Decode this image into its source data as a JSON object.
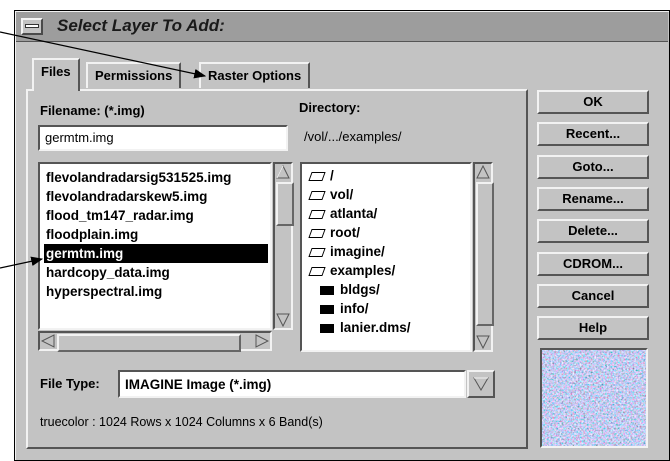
{
  "window": {
    "title": "Select Layer To Add:"
  },
  "tabs": [
    {
      "label": "Files",
      "active": true
    },
    {
      "label": "Permissions"
    },
    {
      "label": "Raster Options"
    }
  ],
  "filename": {
    "label": "Filename: (*.img)",
    "value": "germtm.img"
  },
  "directory": {
    "label": "Directory:",
    "path": "/vol/.../examples/"
  },
  "files": [
    "flevolandradarsig531525.img",
    "flevolandradarskew5.img",
    "flood_tm147_radar.img",
    "floodplain.img",
    "germtm.img",
    "hardcopy_data.img",
    "hyperspectral.img"
  ],
  "selected_file": "germtm.img",
  "directories": [
    {
      "name": "/",
      "icon": "open-folder-icon"
    },
    {
      "name": "vol/",
      "icon": "open-folder-icon"
    },
    {
      "name": "atlanta/",
      "icon": "open-folder-icon"
    },
    {
      "name": "root/",
      "icon": "open-folder-icon"
    },
    {
      "name": "imagine/",
      "icon": "open-folder-icon"
    },
    {
      "name": "examples/",
      "icon": "open-folder-icon"
    },
    {
      "name": "bldgs/",
      "icon": "folder-icon"
    },
    {
      "name": "info/",
      "icon": "folder-icon"
    },
    {
      "name": "lanier.dms/",
      "icon": "folder-icon"
    }
  ],
  "file_type": {
    "label": "File Type:",
    "value": "IMAGINE Image (*.img)"
  },
  "status": "truecolor : 1024 Rows x 1024 Columns x 6 Band(s)",
  "buttons": {
    "ok": "OK",
    "recent": "Recent...",
    "goto": "Goto...",
    "rename": "Rename...",
    "delete": "Delete...",
    "cdrom": "CDROM...",
    "cancel": "Cancel",
    "help": "Help"
  },
  "colors": {
    "dialog": "#c3c3c3",
    "titlebar": "#9d9d9d",
    "selection": "#000000"
  }
}
